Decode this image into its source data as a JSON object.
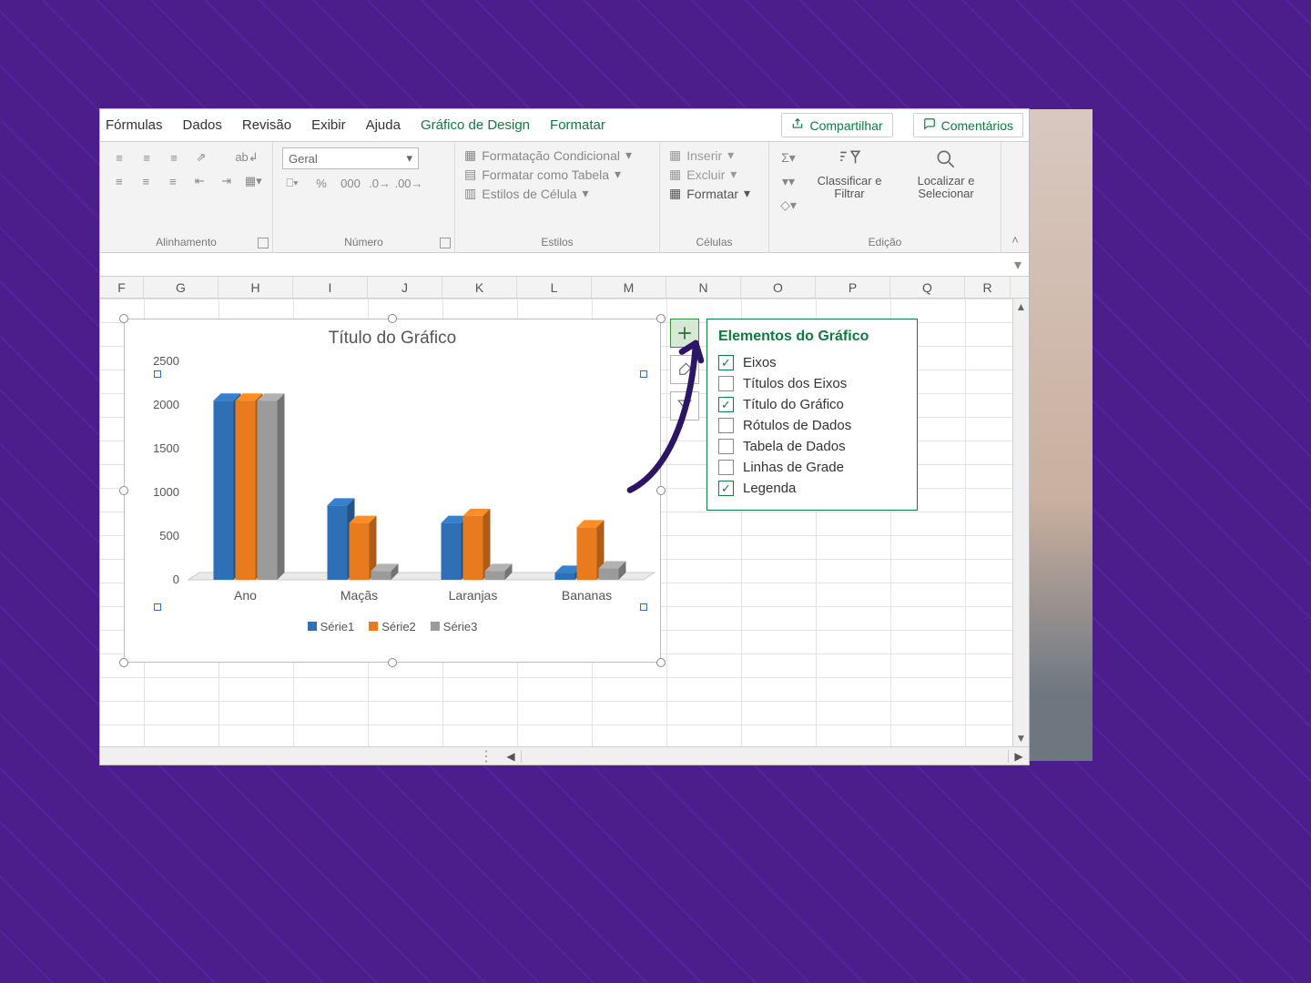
{
  "tabs": {
    "formulas": "Fórmulas",
    "dados": "Dados",
    "revisao": "Revisão",
    "exibir": "Exibir",
    "ajuda": "Ajuda",
    "design": "Gráfico de Design",
    "formatar": "Formatar"
  },
  "actions": {
    "share": "Compartilhar",
    "comments": "Comentários"
  },
  "ribbon": {
    "alignment_label": "Alinhamento",
    "number_label": "Número",
    "number_format": "Geral",
    "styles_label": "Estilos",
    "style_cond": "Formatação Condicional",
    "style_table": "Formatar como Tabela",
    "style_cell": "Estilos de Célula",
    "cells_label": "Células",
    "cells_insert": "Inserir",
    "cells_delete": "Excluir",
    "cells_format": "Formatar",
    "edit_label": "Edição",
    "edit_sort": "Classificar e Filtrar",
    "edit_find": "Localizar e Selecionar"
  },
  "columns": [
    "F",
    "G",
    "H",
    "I",
    "J",
    "K",
    "L",
    "M",
    "N",
    "O",
    "P",
    "Q",
    "R"
  ],
  "chart": {
    "title": "Título do Gráfico",
    "legend": {
      "s1": "Série1",
      "s2": "Série2",
      "s3": "Série3"
    },
    "yticks": [
      "0",
      "500",
      "1000",
      "1500",
      "2000",
      "2500"
    ]
  },
  "chart_data": {
    "type": "bar",
    "title": "Título do Gráfico",
    "categories": [
      "Ano",
      "Maçãs",
      "Laranjas",
      "Bananas"
    ],
    "series": [
      {
        "name": "Série1",
        "color": "#2f6fb5",
        "values": [
          2050,
          850,
          650,
          80
        ]
      },
      {
        "name": "Série2",
        "color": "#e87b1e",
        "values": [
          2050,
          650,
          730,
          600
        ]
      },
      {
        "name": "Série3",
        "color": "#9b9b9b",
        "values": [
          2050,
          100,
          100,
          130
        ]
      }
    ],
    "ylim": [
      0,
      2500
    ],
    "xlabel": "",
    "ylabel": ""
  },
  "popout": {
    "title": "Elementos do Gráfico",
    "items": [
      {
        "label": "Eixos",
        "checked": true
      },
      {
        "label": "Títulos dos Eixos",
        "checked": false
      },
      {
        "label": "Título do Gráfico",
        "checked": true
      },
      {
        "label": "Rótulos de Dados",
        "checked": false
      },
      {
        "label": "Tabela de Dados",
        "checked": false
      },
      {
        "label": "Linhas de Grade",
        "checked": false
      },
      {
        "label": "Legenda",
        "checked": true
      }
    ]
  }
}
